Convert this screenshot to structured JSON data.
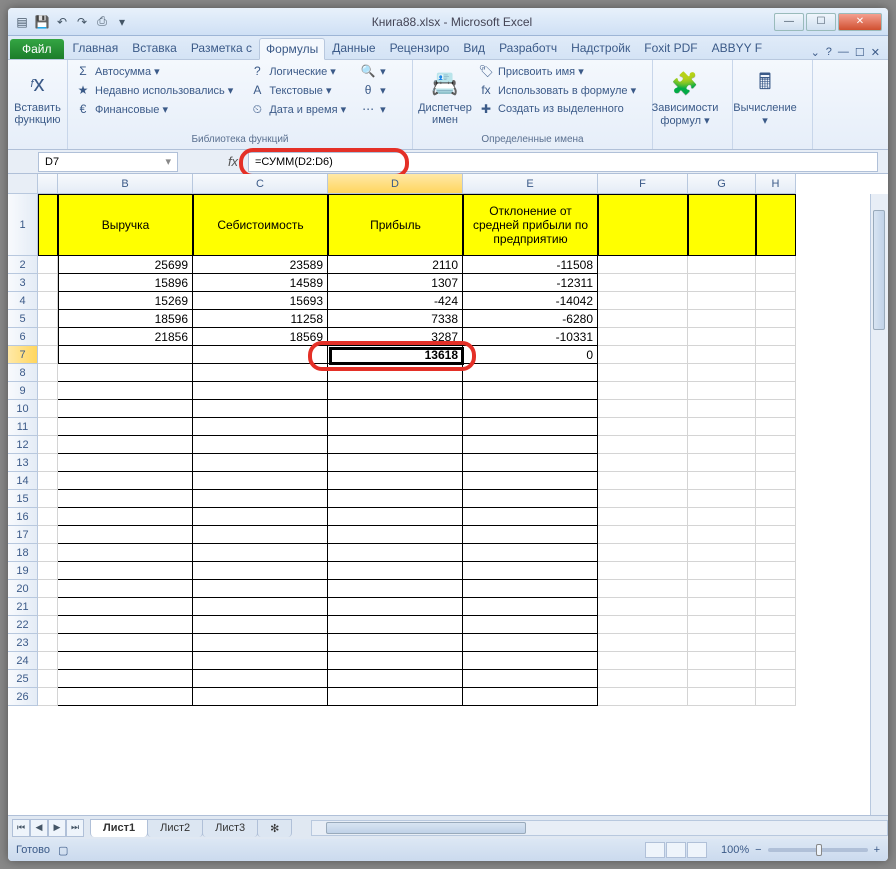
{
  "title": "Книга88.xlsx - Microsoft Excel",
  "qat_icons": [
    "excel",
    "save",
    "undo",
    "redo",
    "print",
    "open"
  ],
  "file_tab": "Файл",
  "tabs": [
    "Главная",
    "Вставка",
    "Разметка с",
    "Формулы",
    "Данные",
    "Рецензиро",
    "Вид",
    "Разработч",
    "Надстройк",
    "Foxit PDF",
    "ABBYY F"
  ],
  "active_tab": "Формулы",
  "ribbon": {
    "insert_fn": {
      "label": "Вставить функцию",
      "icon": "fx"
    },
    "lib_items": [
      {
        "icon": "Σ",
        "label": "Автосумма ▾"
      },
      {
        "icon": "★",
        "label": "Недавно использовались ▾"
      },
      {
        "icon": "€",
        "label": "Финансовые ▾"
      }
    ],
    "lib_items2": [
      {
        "icon": "?",
        "label": "Логические ▾"
      },
      {
        "icon": "A",
        "label": "Текстовые ▾"
      },
      {
        "icon": "⏲",
        "label": "Дата и время ▾"
      }
    ],
    "lib_extra": [
      "🔍",
      "θ",
      "⋯"
    ],
    "lib_label": "Библиотека функций",
    "names_big": {
      "label": "Диспетчер имен",
      "icon": "📇"
    },
    "names_items": [
      {
        "icon": "🏷",
        "label": "Присвоить имя ▾"
      },
      {
        "icon": "fx",
        "label": "Использовать в формуле ▾"
      },
      {
        "icon": "✚",
        "label": "Создать из выделенного"
      }
    ],
    "names_label": "Определенные имена",
    "deps": {
      "label": "Зависимости формул ▾",
      "icon": "🧩"
    },
    "calc": {
      "label": "Вычисление ▾",
      "icon": "🖩"
    }
  },
  "namebox": "D7",
  "formula": "=СУММ(D2:D6)",
  "columns": [
    "",
    "B",
    "C",
    "D",
    "E",
    "F",
    "G",
    "H"
  ],
  "col_widths": [
    "cw-a",
    "cw-b",
    "cw-c",
    "cw-d",
    "cw-e",
    "cw-f",
    "cw-g",
    "cw-h"
  ],
  "selected_col": "D",
  "selected_row": 7,
  "headers_row": [
    "",
    "Выручка",
    "Себистоимость",
    "Прибыль",
    "Отклонение от средней прибыли по предприятию",
    "",
    "",
    ""
  ],
  "data_rows": [
    {
      "r": 2,
      "b": "25699",
      "c": "23589",
      "d": "2110",
      "e": "-11508"
    },
    {
      "r": 3,
      "b": "15896",
      "c": "14589",
      "d": "1307",
      "e": "-12311"
    },
    {
      "r": 4,
      "b": "15269",
      "c": "15693",
      "d": "-424",
      "e": "-14042"
    },
    {
      "r": 5,
      "b": "18596",
      "c": "11258",
      "d": "7338",
      "e": "-6280"
    },
    {
      "r": 6,
      "b": "21856",
      "c": "18569",
      "d": "3287",
      "e": "-10331"
    },
    {
      "r": 7,
      "b": "",
      "c": "",
      "d": "13618",
      "e": "0"
    }
  ],
  "empty_rows": [
    8,
    9,
    10,
    11,
    12,
    13,
    14,
    15,
    16,
    17,
    18,
    19,
    20,
    21,
    22,
    23,
    24,
    25,
    26
  ],
  "sheets": [
    "Лист1",
    "Лист2",
    "Лист3"
  ],
  "active_sheet": "Лист1",
  "status": "Готово",
  "zoom": "100%"
}
